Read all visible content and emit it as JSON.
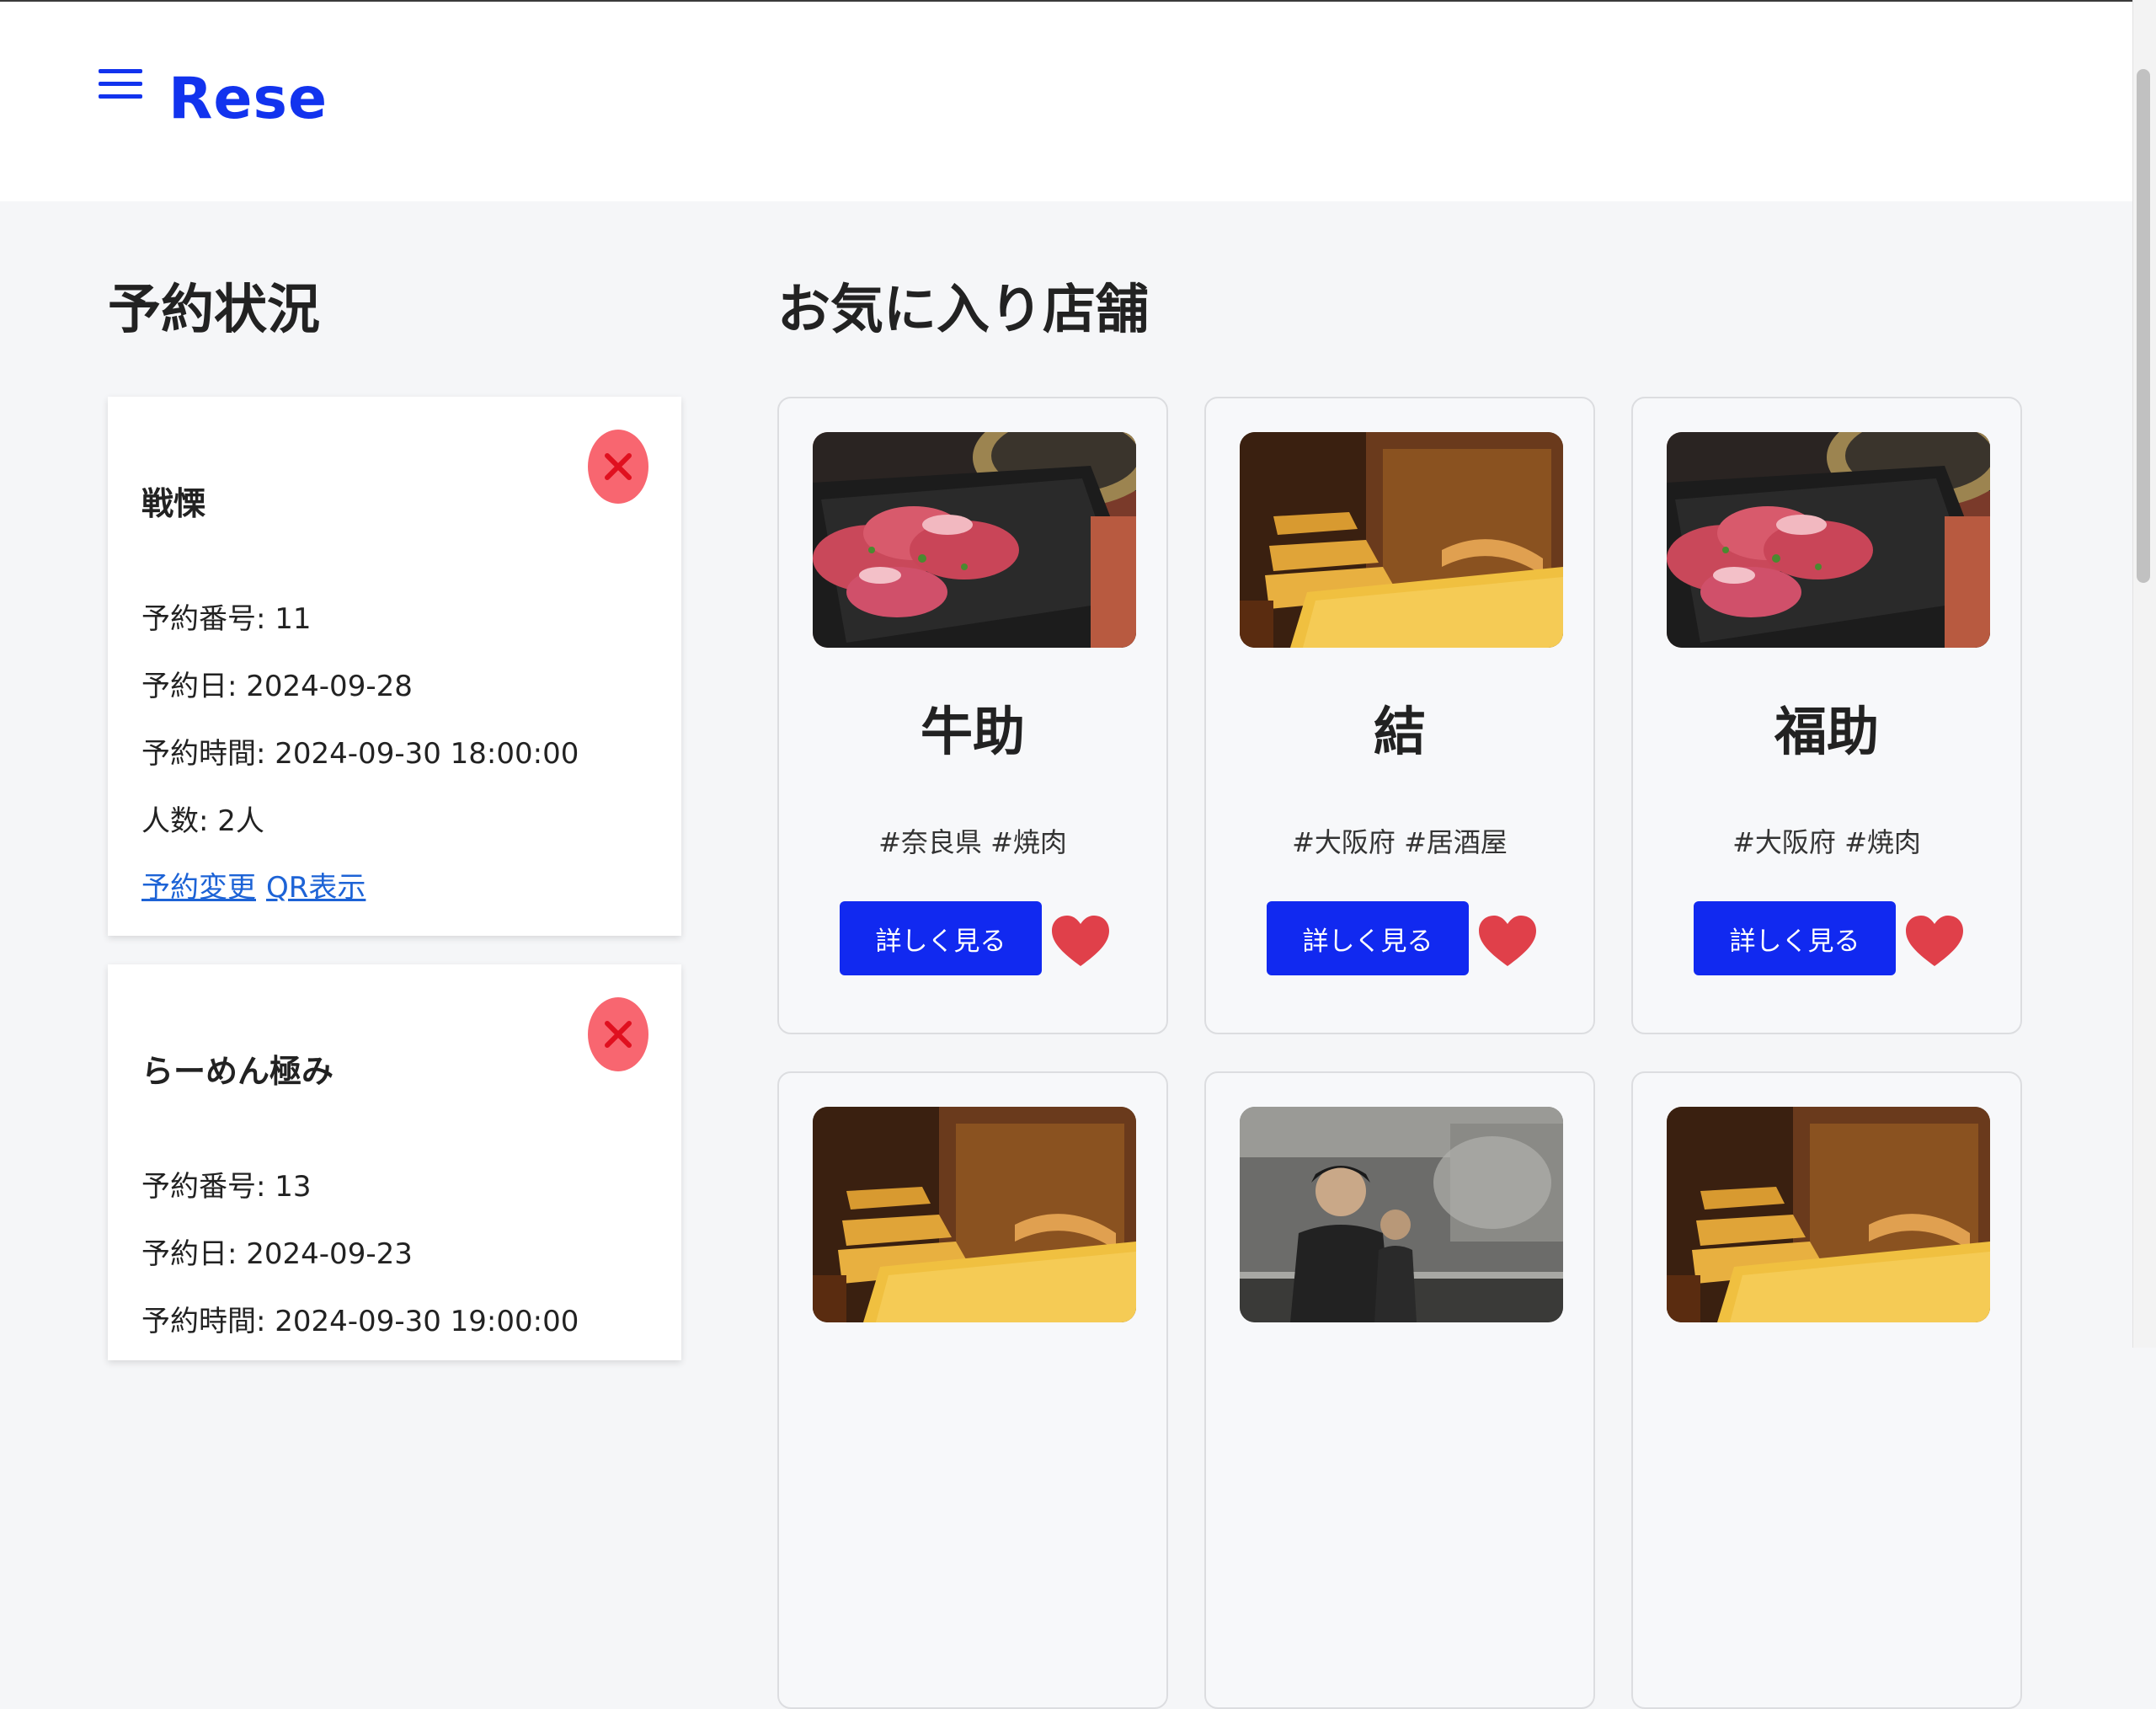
{
  "app": {
    "title": "Rese"
  },
  "icons": {
    "menu": "menu-icon",
    "cancel": "close-icon",
    "favorite": "heart-icon"
  },
  "colors": {
    "brand": "#1233ee",
    "button": "#1129f0",
    "heart": "#e0404a",
    "cancel_bg": "#f86670",
    "cancel_x": "#e0101f",
    "link": "#1d63d6"
  },
  "reservations": {
    "title": "予約状況",
    "items": [
      {
        "name": "戦慄",
        "number": "予約番号: 11",
        "date": "予約日: 2024-09-28",
        "time": "予約時間: 2024-09-30 18:00:00",
        "people": "人数: 2人",
        "change_link": "予約変更",
        "qr_link": "QR表示"
      },
      {
        "name": "らーめん極み",
        "number": "予約番号: 13",
        "date": "予約日: 2024-09-23",
        "time": "予約時間: 2024-09-30 19:00:00"
      }
    ]
  },
  "favorites": {
    "title": "お気に入り店舗",
    "detail_label": "詳しく見る",
    "shops": [
      {
        "name": "牛助",
        "tags": "#奈良県 #焼肉",
        "image": "yakiniku"
      },
      {
        "name": "結",
        "tags": "#大阪府 #居酒屋",
        "image": "izakaya"
      },
      {
        "name": "福助",
        "tags": "#大阪府 #焼肉",
        "image": "yakiniku"
      },
      {
        "image": "izakaya"
      },
      {
        "image": "kitchen"
      },
      {
        "image": "izakaya"
      }
    ]
  }
}
